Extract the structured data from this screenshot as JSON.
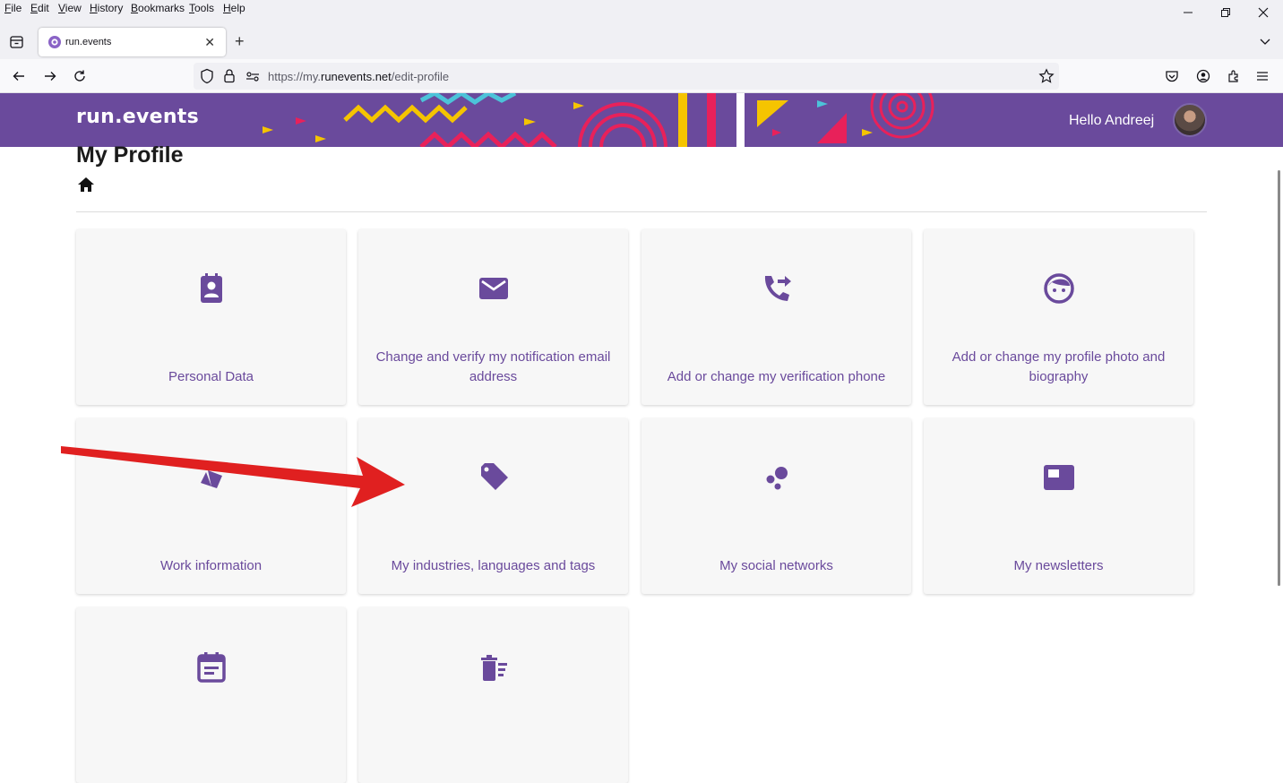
{
  "menubar": {
    "items": [
      "File",
      "Edit",
      "View",
      "History",
      "Bookmarks",
      "Tools",
      "Help"
    ]
  },
  "tab": {
    "title": "run.events"
  },
  "url": {
    "prefix": "https://my.",
    "domain": "runevents.net",
    "path": "/edit-profile"
  },
  "header": {
    "logo_text": "run.events",
    "greeting": "Hello Andreej"
  },
  "page": {
    "title": "My Profile"
  },
  "cards": [
    {
      "label": "Personal Data",
      "icon": "contact-card-icon"
    },
    {
      "label": "Change and verify my notification email address",
      "icon": "mail-icon"
    },
    {
      "label": "Add or change my verification phone",
      "icon": "phone-forward-icon"
    },
    {
      "label": "Add or change my profile photo and biography",
      "icon": "face-icon"
    },
    {
      "label": "Work information",
      "icon": "layers-icon"
    },
    {
      "label": "My industries, languages and tags",
      "icon": "tag-icon"
    },
    {
      "label": "My social networks",
      "icon": "bubbles-icon"
    },
    {
      "label": "My newsletters",
      "icon": "featured-video-icon"
    },
    {
      "label": "",
      "icon": "event-note-icon"
    },
    {
      "label": "",
      "icon": "delete-sweep-icon"
    }
  ],
  "colors": {
    "brand_purple": "#6a4a9c",
    "card_bg": "#f7f7f7",
    "arrow_red": "#e02020"
  }
}
